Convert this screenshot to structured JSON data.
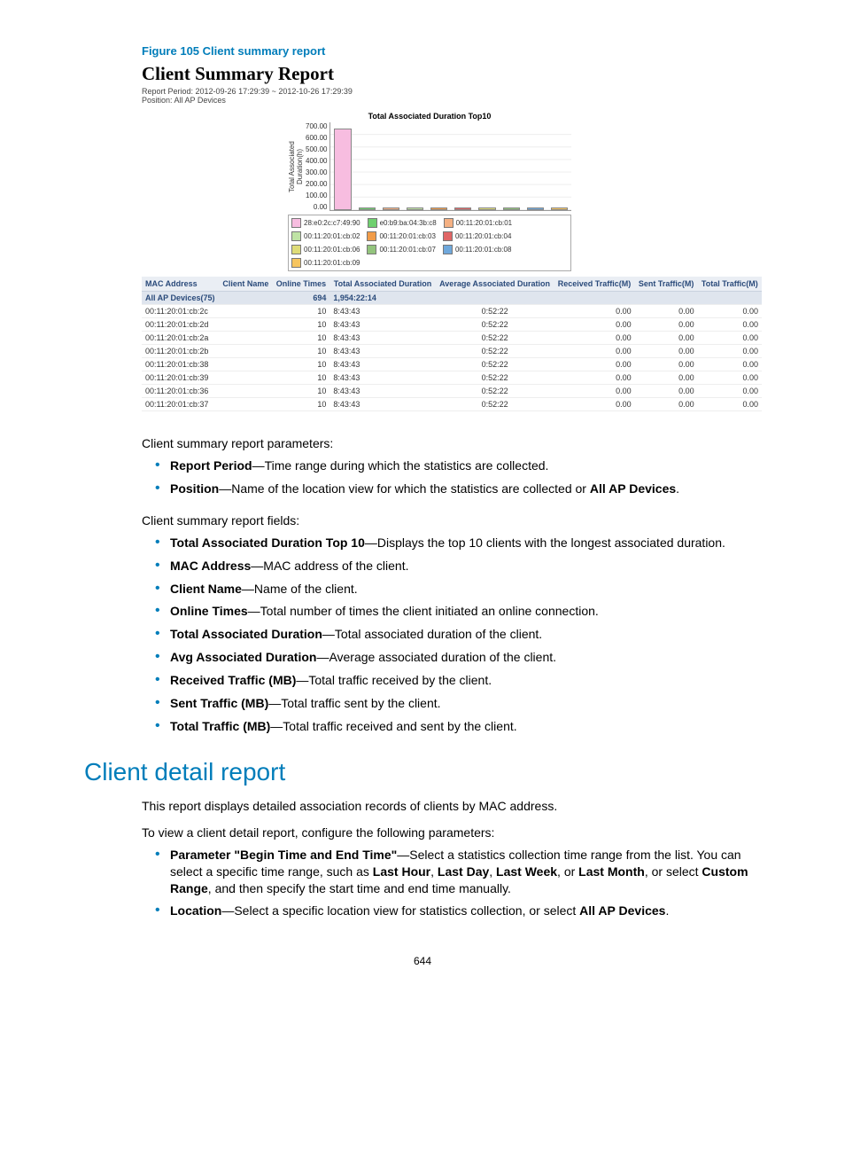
{
  "figure_caption": "Figure 105 Client summary report",
  "report_title": "Client Summary Report",
  "report_period_label": "Report Period: 2012-09-26 17:29:39  ~  2012-10-26 17:29:39",
  "position_label": "Position: All AP Devices",
  "chart_data": {
    "type": "bar",
    "title": "Total Associated Duration Top10",
    "ylabel": "Total Associated Duration(h)",
    "ylim": [
      0,
      700
    ],
    "yticks": [
      "700.00",
      "600.00",
      "500.00",
      "400.00",
      "300.00",
      "200.00",
      "100.00",
      "0.00"
    ],
    "series": [
      {
        "name": "28:e0:2c:c7:49:90",
        "value": 640,
        "color": "#f7bde0"
      },
      {
        "name": "e0:b9:ba:04:3b:c8",
        "value": 8,
        "color": "#6fd06f"
      },
      {
        "name": "00:11:20:01:cb:01",
        "value": 8,
        "color": "#f5b183"
      },
      {
        "name": "00:11:20:01:cb:02",
        "value": 8,
        "color": "#bfe3a5"
      },
      {
        "name": "00:11:20:01:cb:03",
        "value": 8,
        "color": "#f19c49"
      },
      {
        "name": "00:11:20:01:cb:04",
        "value": 8,
        "color": "#e06666"
      },
      {
        "name": "00:11:20:01:cb:06",
        "value": 8,
        "color": "#dedc78"
      },
      {
        "name": "00:11:20:01:cb:07",
        "value": 8,
        "color": "#93c47d"
      },
      {
        "name": "00:11:20:01:cb:08",
        "value": 8,
        "color": "#6fa8dc"
      },
      {
        "name": "00:11:20:01:cb:09",
        "value": 8,
        "color": "#f6c560"
      }
    ]
  },
  "table": {
    "headers": [
      "MAC Address",
      "Client Name",
      "Online Times",
      "Total Associated Duration",
      "Average Associated Duration",
      "Received Traffic(M)",
      "Sent Traffic(M)",
      "Total Traffic(M)"
    ],
    "summary": {
      "label": "All AP Devices(75)",
      "online": "694",
      "total_dur": "1,954:22:14"
    },
    "rows": [
      {
        "mac": "00:11:20:01:cb:2c",
        "name": "",
        "online": "10",
        "tdur": "8:43:43",
        "adur": "0:52:22",
        "recv": "0.00",
        "sent": "0.00",
        "total": "0.00"
      },
      {
        "mac": "00:11:20:01:cb:2d",
        "name": "",
        "online": "10",
        "tdur": "8:43:43",
        "adur": "0:52:22",
        "recv": "0.00",
        "sent": "0.00",
        "total": "0.00"
      },
      {
        "mac": "00:11:20:01:cb:2a",
        "name": "",
        "online": "10",
        "tdur": "8:43:43",
        "adur": "0:52:22",
        "recv": "0.00",
        "sent": "0.00",
        "total": "0.00"
      },
      {
        "mac": "00:11:20:01:cb:2b",
        "name": "",
        "online": "10",
        "tdur": "8:43:43",
        "adur": "0:52:22",
        "recv": "0.00",
        "sent": "0.00",
        "total": "0.00"
      },
      {
        "mac": "00:11:20:01:cb:38",
        "name": "",
        "online": "10",
        "tdur": "8:43:43",
        "adur": "0:52:22",
        "recv": "0.00",
        "sent": "0.00",
        "total": "0.00"
      },
      {
        "mac": "00:11:20:01:cb:39",
        "name": "",
        "online": "10",
        "tdur": "8:43:43",
        "adur": "0:52:22",
        "recv": "0.00",
        "sent": "0.00",
        "total": "0.00"
      },
      {
        "mac": "00:11:20:01:cb:36",
        "name": "",
        "online": "10",
        "tdur": "8:43:43",
        "adur": "0:52:22",
        "recv": "0.00",
        "sent": "0.00",
        "total": "0.00"
      },
      {
        "mac": "00:11:20:01:cb:37",
        "name": "",
        "online": "10",
        "tdur": "8:43:43",
        "adur": "0:52:22",
        "recv": "0.00",
        "sent": "0.00",
        "total": "0.00"
      }
    ]
  },
  "prose": {
    "params_intro": "Client summary report parameters:",
    "param1_bold": "Report Period",
    "param1_rest": "—Time range during which the statistics are collected.",
    "param2_bold": "Position",
    "param2_rest1": "—Name of the location view for which the statistics are collected or ",
    "param2_bold2": "All AP Devices",
    "param2_rest2": ".",
    "fields_intro": "Client summary report fields:",
    "f1_bold": "Total Associated Duration Top 10",
    "f1_rest": "—Displays the top 10 clients with the longest associated duration.",
    "f2_bold": "MAC Address",
    "f2_rest": "—MAC address of the client.",
    "f3_bold": "Client Name",
    "f3_rest": "—Name of the client.",
    "f4_bold": "Online Times",
    "f4_rest": "—Total number of times the client initiated an online connection.",
    "f5_bold": "Total Associated Duration",
    "f5_rest": "—Total associated duration of the client.",
    "f6_bold": "Avg Associated Duration",
    "f6_rest": "—Average associated duration of the client.",
    "f7_bold": "Received Traffic (MB)",
    "f7_rest": "—Total traffic received by the client.",
    "f8_bold": "Sent Traffic (MB)",
    "f8_rest": "—Total traffic sent by the client.",
    "f9_bold": "Total Traffic (MB)",
    "f9_rest": "—Total traffic received and sent by the client."
  },
  "section2": {
    "heading": "Client detail report",
    "p1": "This report displays detailed association records of clients by MAC address.",
    "p2": "To view a client detail report, configure the following parameters:",
    "b1_bold": "Parameter \"Begin Time and End Time\"",
    "b1_rest1": "—Select a statistics collection time range from the list. You can select a specific time range, such as ",
    "b1_bold2": "Last Hour",
    "b1_comma1": ", ",
    "b1_bold3": "Last Day",
    "b1_comma2": ", ",
    "b1_bold4": "Last Week",
    "b1_or": ", or ",
    "b1_bold5": "Last Month",
    "b1_rest2": ", or select ",
    "b1_bold6": "Custom Range",
    "b1_rest3": ", and then specify the start time and end time manually.",
    "b2_bold": "Location",
    "b2_rest1": "—Select a specific location view for statistics collection, or select ",
    "b2_bold2": "All AP Devices",
    "b2_rest2": "."
  },
  "page_number": "644"
}
